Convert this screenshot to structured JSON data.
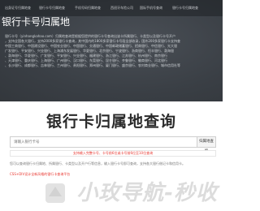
{
  "nav": {
    "items": [
      "出身证号归属地查",
      "银行卡号归属地查",
      "手机号码归属地查",
      "西班牙车险公司",
      "国际手机号查询",
      "银行卡号归属地查"
    ]
  },
  "hero": {
    "title": "银行卡号归属地",
    "lines": [
      "银行卡号（yinhangkahao.com）归属地查询是根据您提供的银行卡号查询出该卡所属银行、卡类型以及银行卡号开户",
      "，支持全国各大银行，支持2000多家银行卡查询，其中国内的1800多家银行卡号段全部收录，国外200多家银行卡支持查",
      "中国工商银行、中国建设银行、中国农业银行、中国银行、交通银行、中国邮政储蓄银行、招商银行、中信银行、光大银",
      "广发银行、平安银行、兴业银行、上海浦东发展银行、华夏银行、北京银行、宁波银行、浙商银行、恒丰银行、渤海银",
      "、渤海银行、华夏银行、广发银行、平安银行、兴业银行、福建银行、浙江银行、江苏银行、杭州银行、南京银行",
      "、天津银行、重庆银行、上海银行、广州银行、汉口银行、东莞银行、昆仑银行、齐鲁银行、徽商银行、河北银行",
      "、长沙银行、成都银行、吉林银行、兰州银行、贵阳银行、郑州银行、厦门银行、盛京银行、农村商业银行、城市信用社等"
    ]
  },
  "main": {
    "title": "银行卡归属地查询",
    "search_placeholder": "请输入银行卡号",
    "search_button": "归属地查询",
    "notice": "支持输入完整卡号、卡号前6位或卡号前6位至10位查询",
    "description": "您可以查询银行卡归属地、所属银行、卡类型以及开户行等信息，输入银行卡号即可查询，支持各大银行借记卡和信用卡。",
    "link_text": "CSS+DIV设计全新风格的银行卡查询平台"
  },
  "watermark": {
    "text": "小玫导航-秒收"
  },
  "colors": {
    "hero_bg": "#3c4147",
    "accent_red": "#e8352e",
    "title_text": "#2a2a2a"
  }
}
